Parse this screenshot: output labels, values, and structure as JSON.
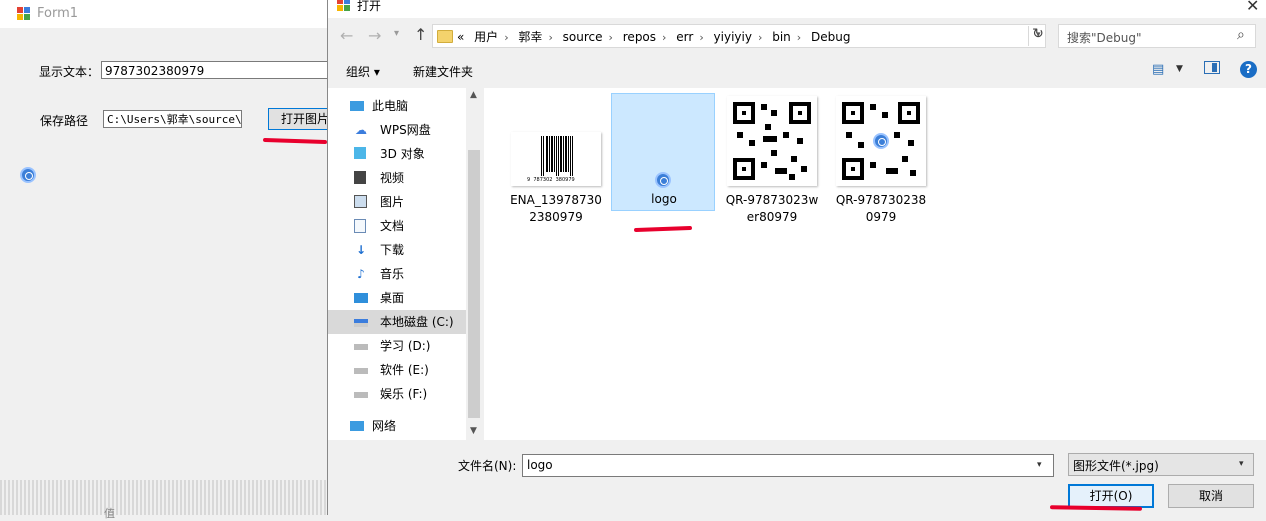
{
  "form1": {
    "title": "Form1",
    "display_text_label": "显示文本：",
    "display_text_value": "9787302380979",
    "save_path_label": "保存路径",
    "save_path_value": "C:\\Users\\郭幸\\source\\r",
    "open_image_button": "打开图片",
    "bottom_text": "值"
  },
  "dialog": {
    "title": "打开",
    "close": "✕",
    "address": {
      "overflow": "«",
      "crumbs": [
        "用户",
        "郭幸",
        "source",
        "repos",
        "err",
        "yiyiyiy",
        "bin",
        "Debug"
      ]
    },
    "search_placeholder": "搜索\"Debug\"",
    "toolbar": {
      "organize": "组织 ▾",
      "new_folder": "新建文件夹",
      "help": "?"
    },
    "nav": {
      "this_pc": "此电脑",
      "items": [
        "WPS网盘",
        "3D 对象",
        "视频",
        "图片",
        "文档",
        "下载",
        "音乐",
        "桌面",
        "本地磁盘 (C:)",
        "学习 (D:)",
        "软件 (E:)",
        "娱乐 (F:)"
      ],
      "network": "网络",
      "selected": "本地磁盘 (C:)"
    },
    "files": [
      {
        "name_l1": "ENA_13978730",
        "name_l2": "2380979",
        "barcode_text": "9  787302  380979"
      },
      {
        "name_l1": "logo",
        "name_l2": ""
      },
      {
        "name_l1": "QR-97873023w",
        "name_l2": "er80979"
      },
      {
        "name_l1": "QR-978730238",
        "name_l2": "0979"
      }
    ],
    "filename_label": "文件名(N):",
    "filename_value": "logo",
    "filter_value": "图形文件(*.jpg)",
    "open_button": "打开(O)",
    "cancel_button": "取消"
  },
  "colors": {
    "accent": "#0078d7",
    "selection": "#cce8ff",
    "annotation": "#e8002d"
  }
}
